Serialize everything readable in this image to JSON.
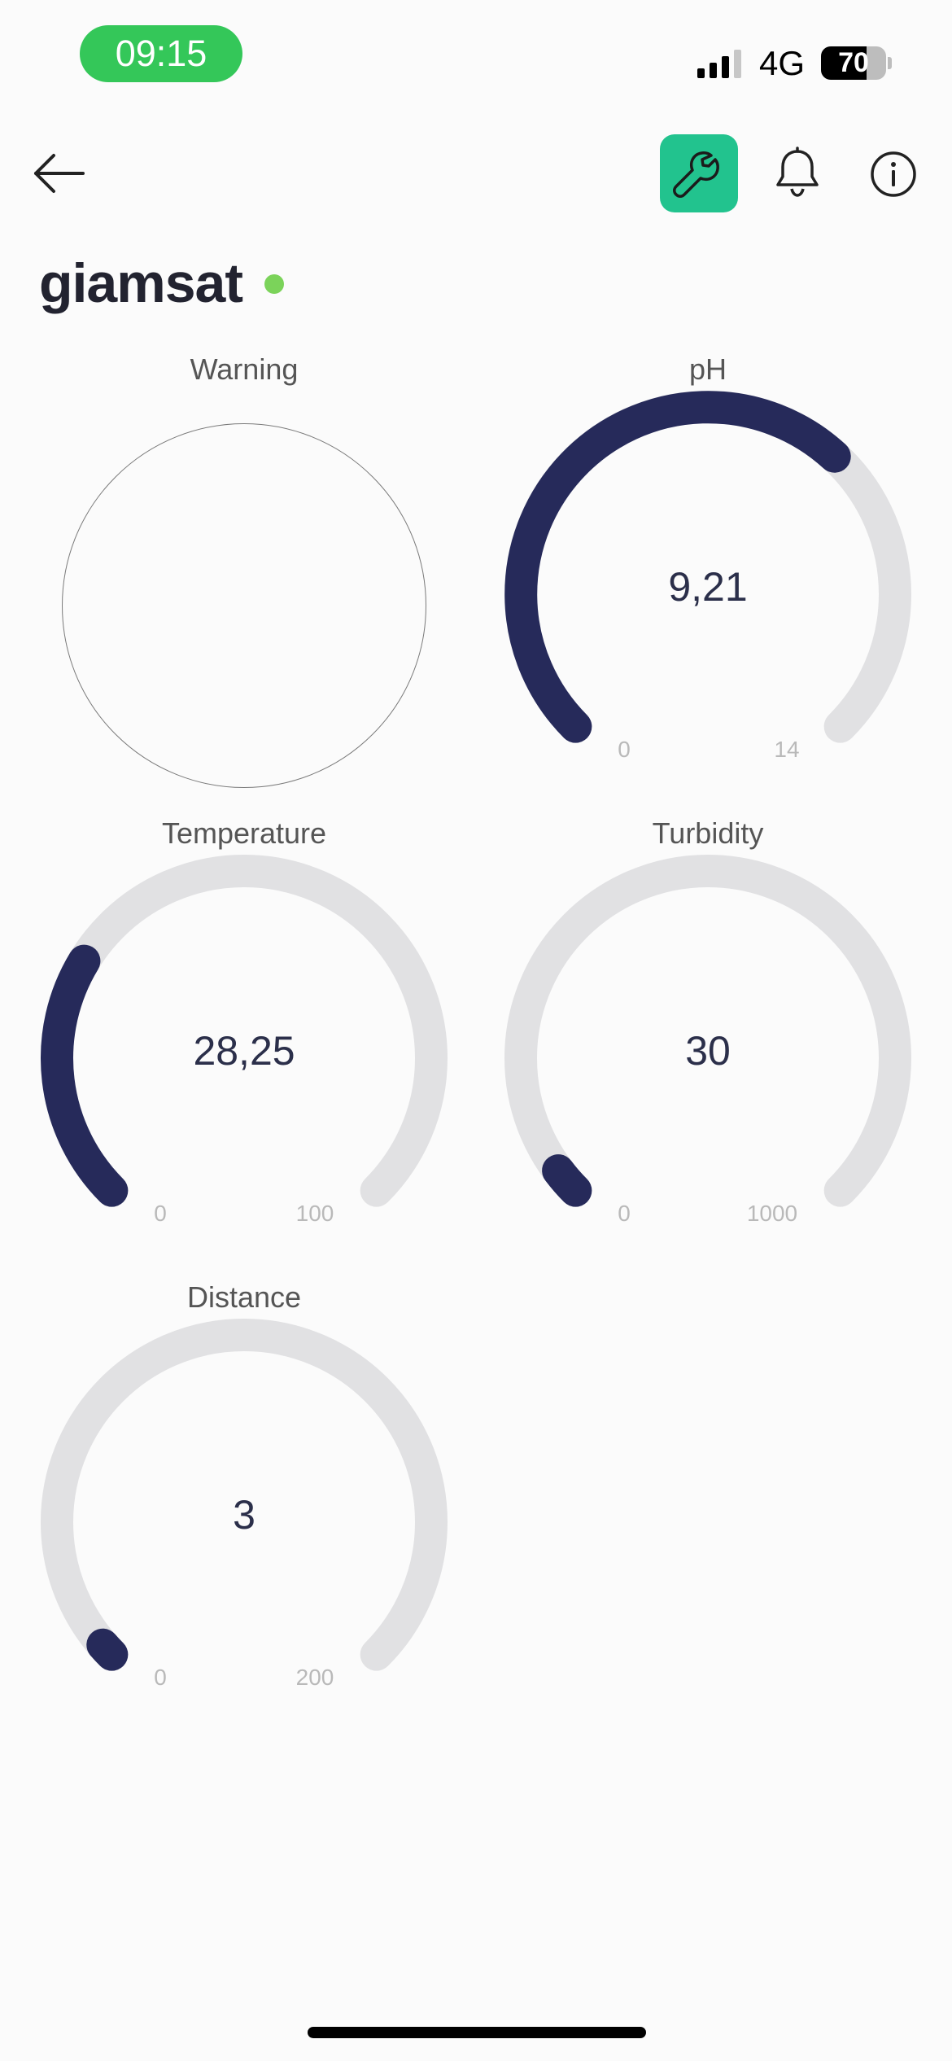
{
  "status_bar": {
    "time": "09:15",
    "network": "4G",
    "battery": 70,
    "battery_label": "70",
    "signal_icon": "cellular-signal-icon",
    "pill_color": "#34c759"
  },
  "toolbar": {
    "back_icon": "arrow-left-icon",
    "tools_icon": "wrench-icon",
    "notifications_icon": "bell-icon",
    "info_icon": "info-icon",
    "accent_color": "#22c38e"
  },
  "device": {
    "name": "giamsat",
    "status_color": "#7bd35a"
  },
  "widgets": {
    "warning": {
      "title": "Warning"
    },
    "ph": {
      "title": "pH",
      "value": 9.21,
      "display": "9,21",
      "min": 0,
      "max": 14,
      "min_label": "0",
      "max_label": "14"
    },
    "temperature": {
      "title": "Temperature",
      "value": 28.25,
      "display": "28,25",
      "min": 0,
      "max": 100,
      "min_label": "0",
      "max_label": "100"
    },
    "turbidity": {
      "title": "Turbidity",
      "value": 30,
      "display": "30",
      "min": 0,
      "max": 1000,
      "min_label": "0",
      "max_label": "1000"
    },
    "distance": {
      "title": "Distance",
      "value": 3,
      "display": "3",
      "min": 0,
      "max": 200,
      "min_label": "0",
      "max_label": "200"
    }
  },
  "colors": {
    "gauge_fill": "#262a5a",
    "gauge_track": "#e1e1e3"
  }
}
